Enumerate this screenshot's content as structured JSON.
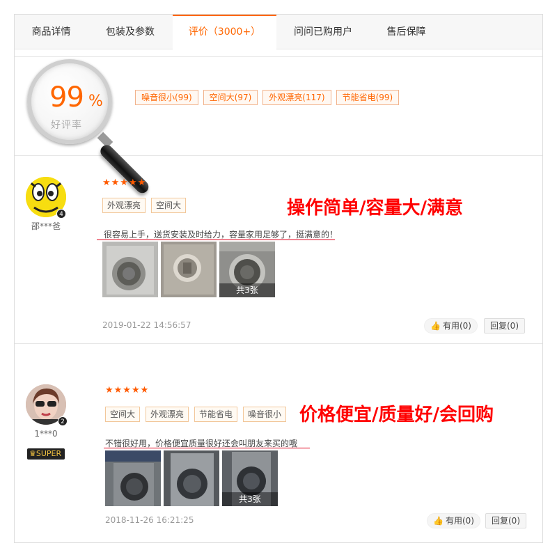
{
  "tabs": [
    {
      "label": "商品详情"
    },
    {
      "label": "包装及参数"
    },
    {
      "label": "评价（3000+）"
    },
    {
      "label": "问问已购用户"
    },
    {
      "label": "售后保障"
    }
  ],
  "summary": {
    "rate_value": "99",
    "rate_sign": "%",
    "rate_label": "好评率",
    "tags": [
      "噪音很小(99)",
      "空间大(97)",
      "外观漂亮(117)",
      "节能省电(99)"
    ]
  },
  "reviews": [
    {
      "user": "邵***爸",
      "level": "4",
      "stars": "★★★★★",
      "tags": [
        "外观漂亮",
        "空间大"
      ],
      "headline": "操作简单/容量大/满意",
      "content": "很容易上手，送货安装及时给力，容量家用足够了，挺满意的！",
      "photo_count_label": "共3张",
      "date": "2019-01-22 14:56:57",
      "useful_label": "有用(0)",
      "reply_label": "回复(0)"
    },
    {
      "user": "1***0",
      "level": "2",
      "badge": "SUPER",
      "stars": "★★★★★",
      "tags": [
        "空间大",
        "外观漂亮",
        "节能省电",
        "噪音很小"
      ],
      "headline": "价格便宜/质量好/会回购",
      "content": "不错很好用，价格便宜质量很好还会叫朋友来买的哦",
      "photo_count_label": "共3张",
      "date": "2018-11-26 16:21:25",
      "useful_label": "有用(0)",
      "reply_label": "回复(0)"
    }
  ],
  "colors": {
    "accent": "#ff6600",
    "headline": "#ff0000",
    "star": "#ff5a00"
  }
}
